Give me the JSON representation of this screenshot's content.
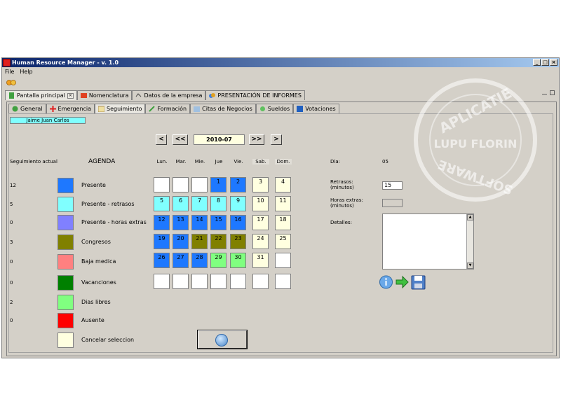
{
  "window": {
    "title": "Human Resource Manager -  v. 1.0"
  },
  "menu": {
    "file": "File",
    "help": "Help"
  },
  "main_tabs": [
    "Pantalla principal",
    "Nomenclatura",
    "Datos de la empresa",
    "PRESENTACIÓN DE INFORMES"
  ],
  "sub_tabs": [
    "General",
    "Emergencia",
    "Seguimiento",
    "Formación",
    "Citas de Negocios",
    "Sueldos",
    "Votaciones"
  ],
  "employee_name": "Jaime Juan Carlos",
  "nav": {
    "first": "<",
    "prev": "<<",
    "next": ">>",
    "last": ">",
    "month": "2010-07"
  },
  "seguimiento_label": "Seguimiento actual",
  "agenda_label": "AGENDA",
  "legend": [
    {
      "count": "12",
      "label": "Presente",
      "color": "#1e78ff"
    },
    {
      "count": "5",
      "label": "Presente - retrasos",
      "color": "#80ffff"
    },
    {
      "count": "0",
      "label": "Presente - horas extras",
      "color": "#8080ff"
    },
    {
      "count": "3",
      "label": "Congresos",
      "color": "#808000"
    },
    {
      "count": "0",
      "label": "Baja medica",
      "color": "#ff8080"
    },
    {
      "count": "0",
      "label": "Vacanciones",
      "color": "#008000"
    },
    {
      "count": "2",
      "label": "Dias libres",
      "color": "#80ff80"
    },
    {
      "count": "0",
      "label": "Ausente",
      "color": "#ff0000"
    },
    {
      "count": "",
      "label": "Cancelar seleccion",
      "color": "#ffffe0"
    }
  ],
  "days": [
    "Lun.",
    "Mar.",
    "Mie.",
    "Jue",
    "Vie.",
    "Sab.",
    "Dom."
  ],
  "calendar": [
    [
      {
        "d": "",
        "c": "#ffffff"
      },
      {
        "d": "",
        "c": "#ffffff"
      },
      {
        "d": "",
        "c": "#ffffff"
      },
      {
        "d": "1",
        "c": "#1e78ff"
      },
      {
        "d": "2",
        "c": "#1e78ff"
      },
      {
        "d": "3",
        "c": "#ffffe0"
      },
      {
        "d": "4",
        "c": "#ffffe0"
      }
    ],
    [
      {
        "d": "5",
        "c": "#80ffff"
      },
      {
        "d": "6",
        "c": "#80ffff"
      },
      {
        "d": "7",
        "c": "#80ffff"
      },
      {
        "d": "8",
        "c": "#80ffff"
      },
      {
        "d": "9",
        "c": "#80ffff"
      },
      {
        "d": "10",
        "c": "#ffffe0"
      },
      {
        "d": "11",
        "c": "#ffffe0"
      }
    ],
    [
      {
        "d": "12",
        "c": "#1e78ff"
      },
      {
        "d": "13",
        "c": "#1e78ff"
      },
      {
        "d": "14",
        "c": "#1e78ff"
      },
      {
        "d": "15",
        "c": "#1e78ff"
      },
      {
        "d": "16",
        "c": "#1e78ff"
      },
      {
        "d": "17",
        "c": "#ffffe0"
      },
      {
        "d": "18",
        "c": "#ffffe0"
      }
    ],
    [
      {
        "d": "19",
        "c": "#1e78ff"
      },
      {
        "d": "20",
        "c": "#1e78ff"
      },
      {
        "d": "21",
        "c": "#808000"
      },
      {
        "d": "22",
        "c": "#808000"
      },
      {
        "d": "23",
        "c": "#808000"
      },
      {
        "d": "24",
        "c": "#ffffe0"
      },
      {
        "d": "25",
        "c": "#ffffe0"
      }
    ],
    [
      {
        "d": "26",
        "c": "#1e78ff"
      },
      {
        "d": "27",
        "c": "#1e78ff"
      },
      {
        "d": "28",
        "c": "#1e78ff"
      },
      {
        "d": "29",
        "c": "#80ff80"
      },
      {
        "d": "30",
        "c": "#80ff80"
      },
      {
        "d": "31",
        "c": "#ffffe0"
      },
      {
        "d": "",
        "c": "#ffffff"
      }
    ],
    [
      {
        "d": "",
        "c": "#ffffff"
      },
      {
        "d": "",
        "c": "#ffffff"
      },
      {
        "d": "",
        "c": "#ffffff"
      },
      {
        "d": "",
        "c": "#ffffff"
      },
      {
        "d": "",
        "c": "#ffffff"
      },
      {
        "d": "",
        "c": "#ffffff"
      },
      {
        "d": "",
        "c": "#ffffff"
      }
    ]
  ],
  "right": {
    "dia_label": "Dia:",
    "dia_value": "05",
    "retrasos_label": "Retrasos:",
    "retrasos_unit": "(minutos)",
    "retrasos_value": "15",
    "horas_label": "Horas extras:",
    "horas_unit": "(minutos)",
    "detalles_label": "Detalles:"
  },
  "watermark": {
    "top": "APLICATIE",
    "middle": "LUPU FLORIN",
    "bottom": "SOFTWARE"
  }
}
